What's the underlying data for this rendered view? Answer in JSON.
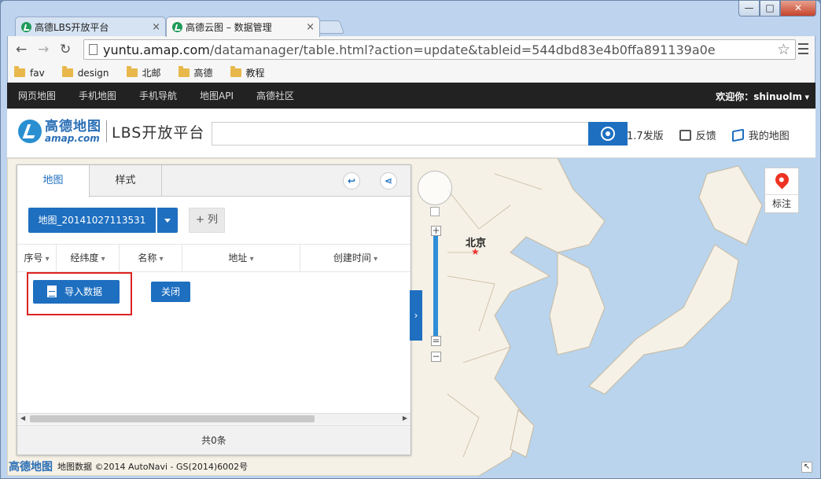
{
  "browser": {
    "tabs": [
      {
        "title": "高德LBS开放平台",
        "close": "×"
      },
      {
        "title": "高德云图 – 数据管理",
        "close": "×"
      }
    ],
    "window_controls": {
      "minimize": "—",
      "maximize": "□",
      "close": "✕"
    },
    "address": {
      "host": "yuntu.amap.com",
      "path": "/datamanager/table.html?action=update&tableid=544dbd83e4b0ffa891139a0e"
    },
    "bookmarks": [
      "fav",
      "design",
      "北邮",
      "高德",
      "教程"
    ]
  },
  "site": {
    "nav": [
      "网页地图",
      "手机地图",
      "手机导航",
      "地图API",
      "高德社区"
    ],
    "welcome": "欢迎你：shinuolm",
    "logo": {
      "cn": "高德地图",
      "en": "amap.com",
      "product": "LBS开放平台"
    },
    "header_links": {
      "version": "1.7发版",
      "feedback": "反馈",
      "my_map": "我的地图"
    }
  },
  "panel": {
    "tabs": [
      "地图",
      "样式"
    ],
    "layer_name": "地图_20141027113531",
    "add_column": "+ 列",
    "columns": [
      "序号",
      "经纬度",
      "名称",
      "地址",
      "创建时间"
    ],
    "import_button": "导入数据",
    "close_button": "关闭",
    "footer": "共0条",
    "collapse": "›",
    "export_icon": "↩",
    "share_icon": "⋖"
  },
  "map": {
    "city_label": "北京",
    "city_marker": "★",
    "mark_label": "标注",
    "copyright_logo": "高德地图",
    "copyright": "地图数据 ©2014 AutoNavi - GS(2014)6002号",
    "zoom_in": "+",
    "zoom_out": "−",
    "corner": "↖"
  }
}
